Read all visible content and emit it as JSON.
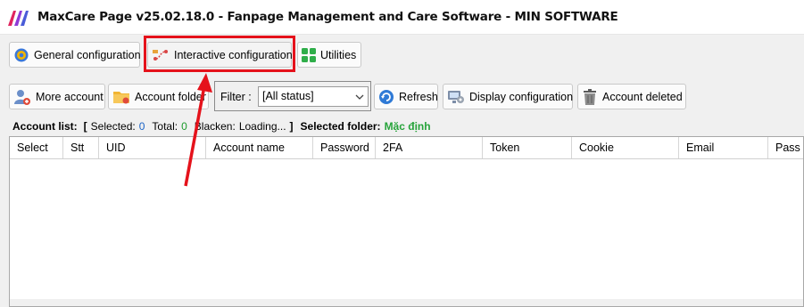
{
  "window": {
    "title": "MaxCare Page v25.02.18.0 -  Fanpage Management and Care Software - MIN SOFTWARE"
  },
  "tabs": [
    {
      "label": "General configuration",
      "icon": "gear-icon"
    },
    {
      "label": "Interactive configuration",
      "icon": "route-icon"
    },
    {
      "label": "Utilities",
      "icon": "grid-icon"
    }
  ],
  "toolbar": {
    "more_account": "More account",
    "account_folder": "Account folder",
    "filter_label": "Filter :",
    "filter_value": "[All status]",
    "refresh": "Refresh",
    "display_configuration": "Display configuration",
    "account_deleted": "Account deleted"
  },
  "status": {
    "account_list_label": "Account list:",
    "open_bracket": "[",
    "selected_label": "Selected:",
    "selected_value": "0",
    "total_label": "Total:",
    "total_value": "0",
    "blacken_label": "Blacken:",
    "blacken_value": "Loading...",
    "close_bracket": "]",
    "selected_folder_label": "Selected folder:",
    "selected_folder_value": "Mặc định"
  },
  "grid": {
    "columns": [
      "Select",
      "Stt",
      "UID",
      "Account name",
      "Password",
      "2FA",
      "Token",
      "Cookie",
      "Email",
      "Pass e"
    ]
  },
  "colors": {
    "highlight": "#e5121b",
    "annotation_arrow": "#e5121b",
    "desktop": "#7a3fe0"
  }
}
